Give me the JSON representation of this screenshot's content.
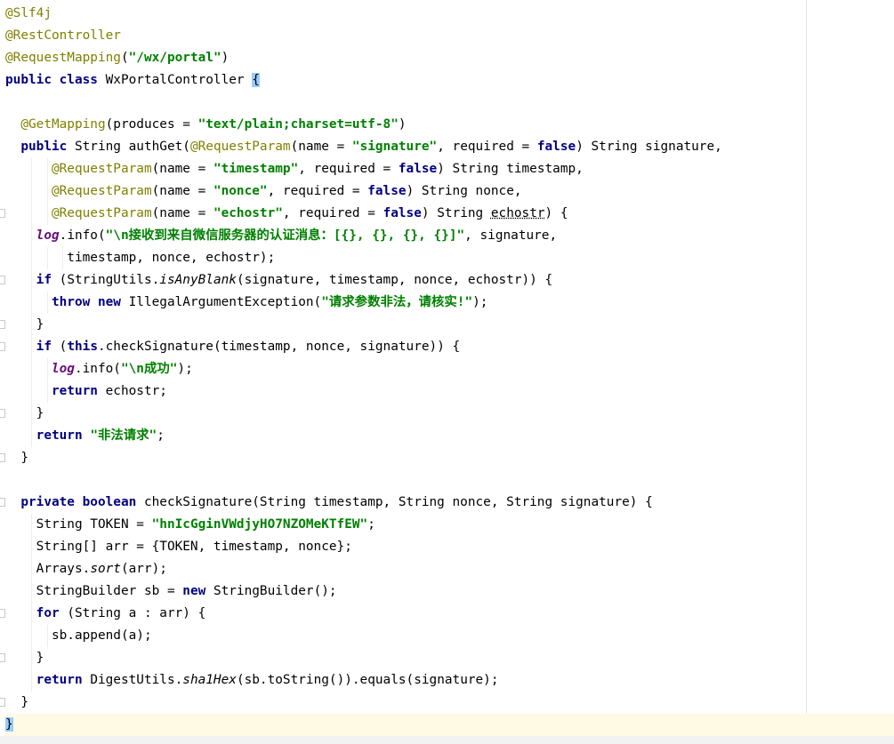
{
  "editor": {
    "lines": [
      [
        [
          "ann",
          "@Slf4j"
        ]
      ],
      [
        [
          "ann",
          "@RestController"
        ]
      ],
      [
        [
          "ann",
          "@RequestMapping"
        ],
        [
          "",
          "("
        ],
        [
          "str",
          "\"/wx/portal\""
        ],
        [
          "",
          ")"
        ]
      ],
      [
        [
          "kw",
          "public class "
        ],
        [
          "",
          "WxPortalController "
        ],
        [
          "brace",
          "{"
        ]
      ],
      [],
      [
        [
          "",
          "  "
        ],
        [
          "ann",
          "@GetMapping"
        ],
        [
          "",
          "(produces = "
        ],
        [
          "str",
          "\"text/plain;charset=utf-8\""
        ],
        [
          "",
          ")"
        ]
      ],
      [
        [
          "",
          "  "
        ],
        [
          "kw",
          "public "
        ],
        [
          "",
          "String authGet("
        ],
        [
          "ann",
          "@RequestParam"
        ],
        [
          "",
          "(name = "
        ],
        [
          "str",
          "\"signature\""
        ],
        [
          "",
          ", required = "
        ],
        [
          "kw",
          "false"
        ],
        [
          "",
          ") String signature,"
        ]
      ],
      [
        [
          "",
          "      "
        ],
        [
          "ann",
          "@RequestParam"
        ],
        [
          "",
          "(name = "
        ],
        [
          "str",
          "\"timestamp\""
        ],
        [
          "",
          ", required = "
        ],
        [
          "kw",
          "false"
        ],
        [
          "",
          ") String timestamp,"
        ]
      ],
      [
        [
          "",
          "      "
        ],
        [
          "ann",
          "@RequestParam"
        ],
        [
          "",
          "(name = "
        ],
        [
          "str",
          "\"nonce\""
        ],
        [
          "",
          ", required = "
        ],
        [
          "kw",
          "false"
        ],
        [
          "",
          ") String nonce,"
        ]
      ],
      [
        [
          "",
          "      "
        ],
        [
          "ann",
          "@RequestParam"
        ],
        [
          "",
          "(name = "
        ],
        [
          "str",
          "\"echostr\""
        ],
        [
          "",
          ", required = "
        ],
        [
          "kw",
          "false"
        ],
        [
          "",
          ") String "
        ],
        [
          "uline",
          "echostr"
        ],
        [
          "",
          ") {"
        ]
      ],
      [
        [
          "",
          "    "
        ],
        [
          "field",
          "log"
        ],
        [
          "",
          ".info("
        ],
        [
          "str",
          "\"\\n接收到来自微信服务器的认证消息：[{}, {}, {}, {}]\""
        ],
        [
          "",
          ", signature,"
        ]
      ],
      [
        [
          "",
          "        timestamp, nonce, echostr);"
        ]
      ],
      [
        [
          "",
          "    "
        ],
        [
          "kw",
          "if "
        ],
        [
          "",
          "(StringUtils."
        ],
        [
          "static",
          "isAnyBlank"
        ],
        [
          "",
          "(signature, timestamp, nonce, echostr)) {"
        ]
      ],
      [
        [
          "",
          "      "
        ],
        [
          "kw",
          "throw new "
        ],
        [
          "",
          "IllegalArgumentException("
        ],
        [
          "str",
          "\"请求参数非法，请核实!\""
        ],
        [
          "",
          ");"
        ]
      ],
      [
        [
          "",
          "    }"
        ]
      ],
      [
        [
          "",
          "    "
        ],
        [
          "kw",
          "if "
        ],
        [
          "",
          "("
        ],
        [
          "kw",
          "this"
        ],
        [
          "",
          ".checkSignature(timestamp, nonce, signature)) {"
        ]
      ],
      [
        [
          "",
          "      "
        ],
        [
          "field",
          "log"
        ],
        [
          "",
          ".info("
        ],
        [
          "str",
          "\"\\n成功\""
        ],
        [
          "",
          ");"
        ]
      ],
      [
        [
          "",
          "      "
        ],
        [
          "kw",
          "return "
        ],
        [
          "",
          "echostr;"
        ]
      ],
      [
        [
          "",
          "    }"
        ]
      ],
      [
        [
          "",
          "    "
        ],
        [
          "kw",
          "return "
        ],
        [
          "str",
          "\"非法请求\""
        ],
        [
          "",
          ";"
        ]
      ],
      [
        [
          "",
          "  }"
        ]
      ],
      [],
      [
        [
          "",
          "  "
        ],
        [
          "kw",
          "private boolean "
        ],
        [
          "",
          "checkSignature(String timestamp, String nonce, String signature) {"
        ]
      ],
      [
        [
          "",
          "    String TOKEN = "
        ],
        [
          "str",
          "\"hnIcGginVWdjyHO7NZOMeKTfEW\""
        ],
        [
          "",
          ";"
        ]
      ],
      [
        [
          "",
          "    String[] arr = {TOKEN, timestamp, nonce};"
        ]
      ],
      [
        [
          "",
          "    Arrays."
        ],
        [
          "static",
          "sort"
        ],
        [
          "",
          "(arr);"
        ]
      ],
      [
        [
          "",
          "    StringBuilder sb = "
        ],
        [
          "kw",
          "new "
        ],
        [
          "",
          "StringBuilder();"
        ]
      ],
      [
        [
          "",
          "    "
        ],
        [
          "kw",
          "for "
        ],
        [
          "",
          "(String a : arr) {"
        ]
      ],
      [
        [
          "",
          "      sb.append(a);"
        ]
      ],
      [
        [
          "",
          "    }"
        ]
      ],
      [
        [
          "",
          "    "
        ],
        [
          "kw",
          "return "
        ],
        [
          "",
          "DigestUtils."
        ],
        [
          "static",
          "sha1Hex"
        ],
        [
          "",
          "(sb.toString()).equals(signature);"
        ]
      ],
      [
        [
          "",
          "  }"
        ]
      ],
      [
        [
          "brace",
          "}"
        ]
      ]
    ],
    "current_line": 32,
    "fold_marker_lines": [
      9,
      12,
      14,
      15,
      18,
      20,
      22,
      27,
      29,
      31
    ]
  }
}
